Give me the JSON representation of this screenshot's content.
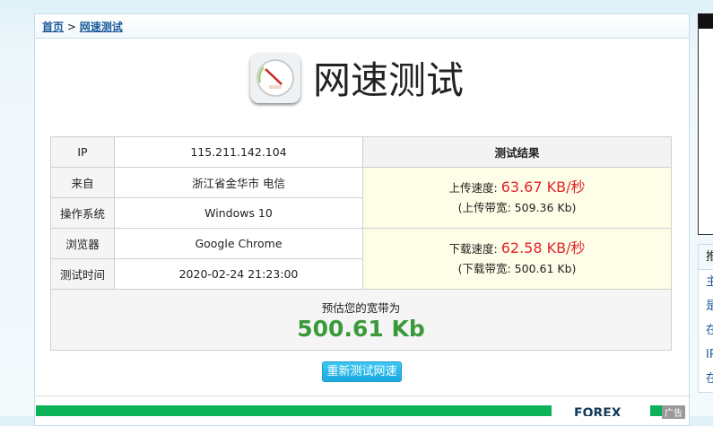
{
  "breadcrumb": {
    "home": "首页",
    "sep": ">",
    "current": "网速测试"
  },
  "title": "网速测试",
  "table": {
    "rows": [
      {
        "label": "IP",
        "value": "115.211.142.104"
      },
      {
        "label": "来自",
        "value": "浙江省金华市 电信"
      },
      {
        "label": "操作系统",
        "value": "Windows 10"
      },
      {
        "label": "浏览器",
        "value": "Google Chrome"
      },
      {
        "label": "测试时间",
        "value": "2020-02-24 21:23:00"
      }
    ],
    "result_header": "测试结果",
    "upload": {
      "label": "上传速度:",
      "speed": "63.67 KB/秒",
      "bandwidth": "(上传带宽: 509.36 Kb)"
    },
    "download": {
      "label": "下载速度:",
      "speed": "62.58 KB/秒",
      "bandwidth": "(下载带宽: 500.61 Kb)"
    },
    "estimate_label": "预估您的宽带为",
    "estimate_value": "500.61 Kb"
  },
  "retest_button": "重新测试网速",
  "ad": {
    "brand": "FOREX",
    "tag": "广告"
  },
  "sidebar": {
    "header": "推",
    "items": [
      "主",
      "是",
      "在",
      "IP",
      "在"
    ]
  }
}
